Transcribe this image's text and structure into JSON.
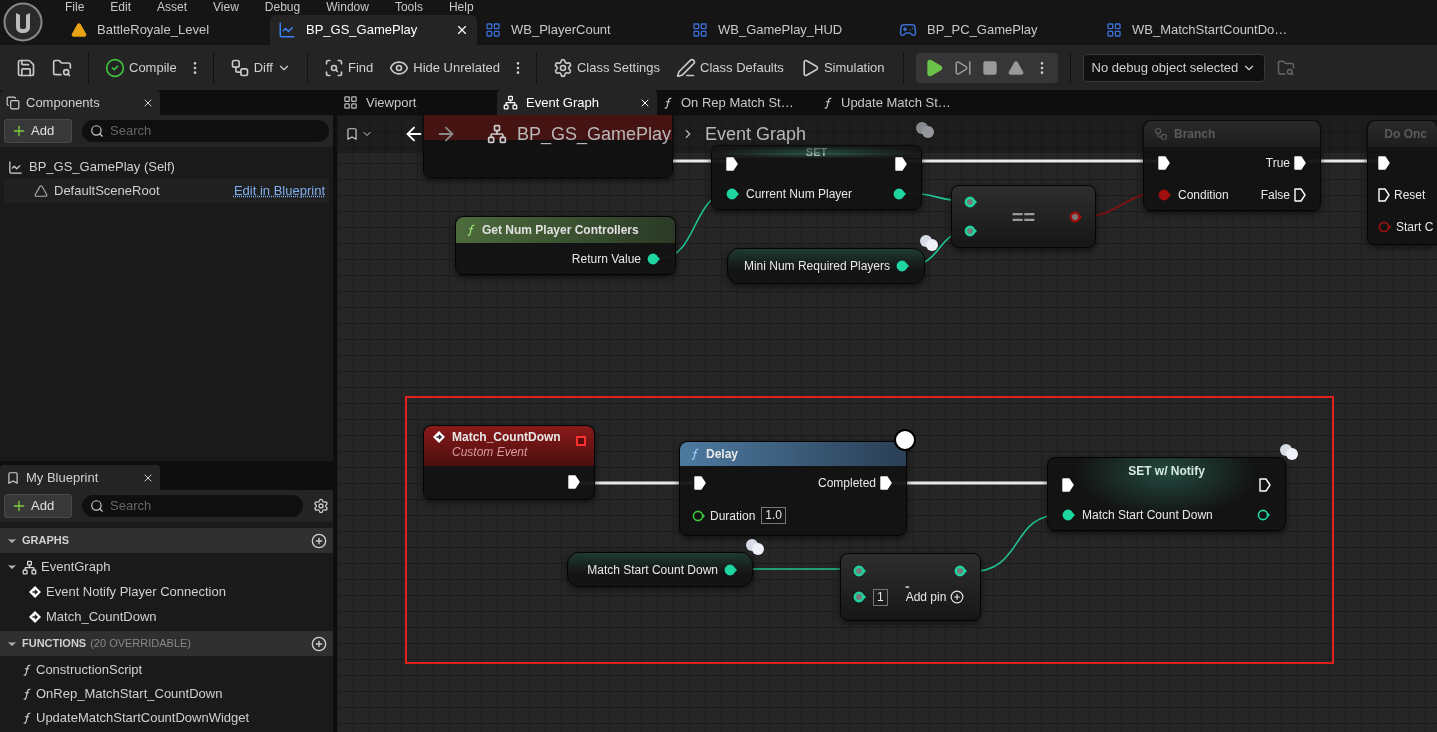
{
  "menu": [
    "File",
    "Edit",
    "Asset",
    "View",
    "Debug",
    "Window",
    "Tools",
    "Help"
  ],
  "document_tabs": [
    {
      "label": "BattleRoyale_Level",
      "kind": "level",
      "selected": false
    },
    {
      "label": "BP_GS_GamePlay",
      "kind": "blueprint",
      "selected": true
    },
    {
      "label": "WB_PlayerCount",
      "kind": "widget",
      "selected": false
    },
    {
      "label": "WB_GamePlay_HUD",
      "kind": "widget",
      "selected": false
    },
    {
      "label": "BP_PC_GamePlay",
      "kind": "controller",
      "selected": false
    },
    {
      "label": "WB_MatchStartCountDo…",
      "kind": "widget",
      "selected": false
    }
  ],
  "toolbar": {
    "items": [
      {
        "kind": "save"
      },
      {
        "kind": "browse"
      },
      {
        "kind": "compile",
        "label": "Compile"
      },
      {
        "kind": "more"
      },
      {
        "kind": "diff",
        "label": "Diff"
      },
      {
        "kind": "find",
        "label": "Find"
      },
      {
        "kind": "hide_unrelated",
        "label": "Hide Unrelated"
      },
      {
        "kind": "more"
      },
      {
        "kind": "class_settings",
        "label": "Class Settings"
      },
      {
        "kind": "class_defaults",
        "label": "Class Defaults"
      },
      {
        "kind": "simulation",
        "label": "Simulation"
      }
    ],
    "play_controls": [
      {
        "kind": "play"
      },
      {
        "kind": "step"
      },
      {
        "kind": "stop"
      },
      {
        "kind": "eject"
      }
    ],
    "debug_dropdown": "No debug object selected"
  },
  "components_panel": {
    "title": "Components",
    "add": "Add",
    "search_placeholder": "Search",
    "tree": [
      {
        "label": "BP_GS_GamePlay (Self)",
        "children": [
          {
            "label": "DefaultSceneRoot",
            "link": "Edit in Blueprint"
          }
        ]
      }
    ]
  },
  "my_blueprint": {
    "title": "My Blueprint",
    "add": "Add",
    "search_placeholder": "Search",
    "sections": [
      {
        "title": "GRAPHS",
        "items": [
          {
            "label": "EventGraph",
            "kind": "graph",
            "children": [
              {
                "label": "Event Notify Player Connection",
                "kind": "event"
              },
              {
                "label": "Match_CountDown",
                "kind": "event"
              }
            ]
          }
        ]
      },
      {
        "title": "FUNCTIONS",
        "note": "(20 OVERRIDABLE)",
        "items": [
          {
            "label": "ConstructionScript",
            "kind": "construction"
          },
          {
            "label": "OnRep_MatchStart_CountDown",
            "kind": "function"
          },
          {
            "label": "UpdateMatchStartCountDownWidget",
            "kind": "function"
          }
        ]
      }
    ]
  },
  "graph_tabs": [
    {
      "label": "Viewport",
      "kind": "viewport",
      "selected": false
    },
    {
      "label": "Event Graph",
      "kind": "graph",
      "selected": true
    },
    {
      "label": "On Rep Match St…",
      "kind": "function",
      "selected": false
    },
    {
      "label": "Update Match St…",
      "kind": "function",
      "selected": false
    }
  ],
  "breadcrumb": [
    "BP_GS_GamePlay",
    "Event Graph"
  ],
  "nodes": [
    {
      "kind": "hidden_event"
    },
    {
      "kind": "set",
      "title": "SET",
      "pin": "Current Num Player"
    },
    {
      "kind": "function",
      "title": "Get Num Player Controllers",
      "pin": "Return Value"
    },
    {
      "kind": "variable",
      "label": "Mini Num Required Players"
    },
    {
      "kind": "operator",
      "symbol": "=="
    },
    {
      "kind": "branch",
      "title": "Branch",
      "pins": [
        "True",
        "Condition",
        "False"
      ]
    },
    {
      "kind": "do_once",
      "title": "Do Onc",
      "pins": [
        "Reset",
        "Start C"
      ]
    },
    {
      "kind": "custom_event",
      "title": "Match_CountDown",
      "subtitle": "Custom Event"
    },
    {
      "kind": "delay",
      "title": "Delay",
      "pins": [
        "Completed",
        "Duration"
      ],
      "value": "1.0"
    },
    {
      "kind": "set_notify",
      "title": "SET w/ Notify",
      "pin": "Match Start Count Down"
    },
    {
      "kind": "variable",
      "label": "Match Start Count Down"
    },
    {
      "kind": "subtract",
      "symbol": "-",
      "value": "1",
      "add_pin": "Add pin"
    }
  ]
}
